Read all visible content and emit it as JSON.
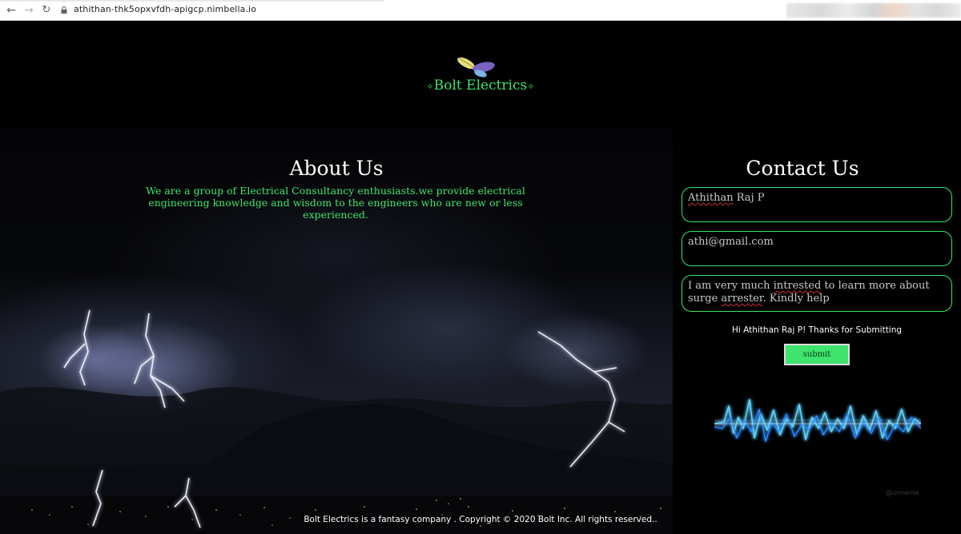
{
  "browser": {
    "url": "athithan-thk5opxvfdh-apigcp.nimbella.io"
  },
  "header": {
    "brand": "Bolt Electrics",
    "brand_ornament": "✧"
  },
  "about": {
    "title": "About Us",
    "text": "We are a group of Electrical Consultancy enthusiasts.we provide electrical engineering knowledge and wisdom to the engineers who are new or less experienced."
  },
  "contact": {
    "title": "Contact Us",
    "name_value_first": "Athithan",
    "name_value_rest": " Raj P",
    "email_value": "athi@gmail.com",
    "message_before": "I am very much ",
    "message_misspelled_1": "intrested",
    "message_middle": " to learn more about surge ",
    "message_misspelled_2": "arrester",
    "message_after": ". Kindly help",
    "thanks_message": "Hi Athithan Raj P! Thanks for Submitting",
    "submit_label": "submit",
    "watermark": "@urmeme"
  },
  "footer": {
    "text": "Bolt Electrics is a fantasy company . Copyright © 2020 Bolt Inc. All rights reserved.."
  },
  "colors": {
    "accent_green": "#3ee46b",
    "background": "#000000",
    "heading_white": "#ffffff"
  }
}
